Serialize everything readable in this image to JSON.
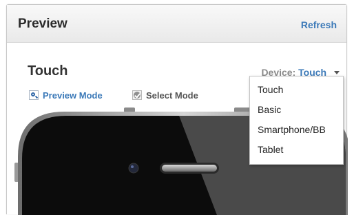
{
  "header": {
    "title": "Preview",
    "refresh_label": "Refresh"
  },
  "section": {
    "title": "Touch"
  },
  "device": {
    "label": "Device:",
    "value": "Touch"
  },
  "modes": {
    "preview_label": "Preview Mode",
    "select_label": "Select Mode"
  },
  "dropdown": {
    "options": [
      "Touch",
      "Basic",
      "Smartphone/BB",
      "Tablet"
    ]
  },
  "colors": {
    "link": "#3b79b8",
    "phone_body": "#0c0c0c"
  },
  "icons": {
    "preview_mode": "magnifier-icon",
    "select_mode": "checkmark-icon",
    "dropdown_caret": "caret-down-icon"
  }
}
